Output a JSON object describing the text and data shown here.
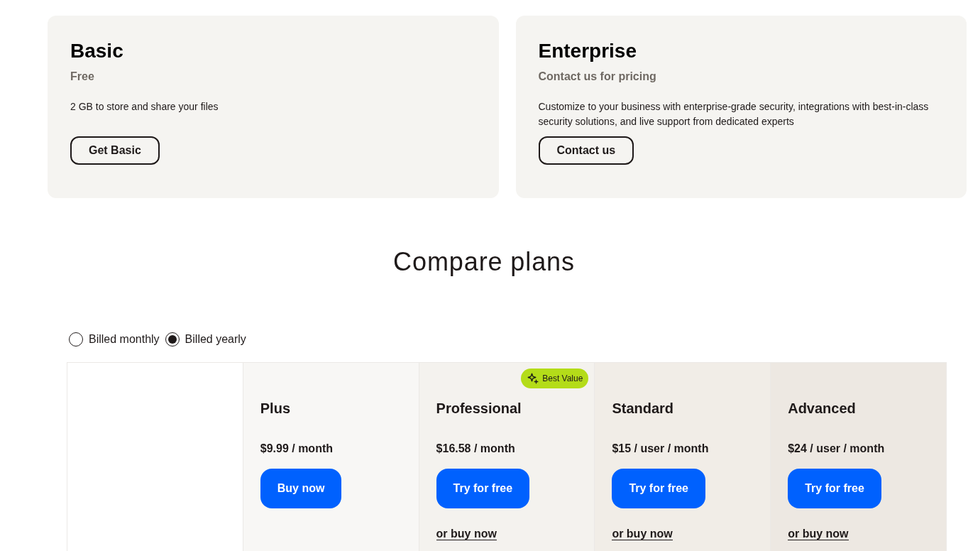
{
  "top_plans": [
    {
      "name": "Basic",
      "price": "Free",
      "description": "2 GB to store and share your files",
      "button": "Get Basic"
    },
    {
      "name": "Enterprise",
      "price": "Contact us for pricing",
      "description": "Customize to your business with enterprise-grade security, integrations with best-in-class security solutions, and live support from dedicated experts",
      "button": "Contact us"
    }
  ],
  "compare": {
    "title": "Compare plans",
    "billing": [
      {
        "label": "Billed monthly",
        "selected": false
      },
      {
        "label": "Billed yearly",
        "selected": true
      }
    ],
    "plans": [
      {
        "name": "Plus",
        "price": "$9.99 / month",
        "button": "Buy now",
        "color": "#f8f7f5"
      },
      {
        "name": "Professional",
        "price": "$16.58 / month",
        "button": "Try for free",
        "link": "or buy now",
        "badge": "Best Value",
        "color": "#f4f2ee"
      },
      {
        "name": "Standard",
        "price": "$15 / user / month",
        "button": "Try for free",
        "link": "or buy now",
        "color": "#f1ede7"
      },
      {
        "name": "Advanced",
        "price": "$24 / user / month",
        "button": "Try for free",
        "link": "or buy now",
        "color": "#ede8e2"
      }
    ]
  }
}
